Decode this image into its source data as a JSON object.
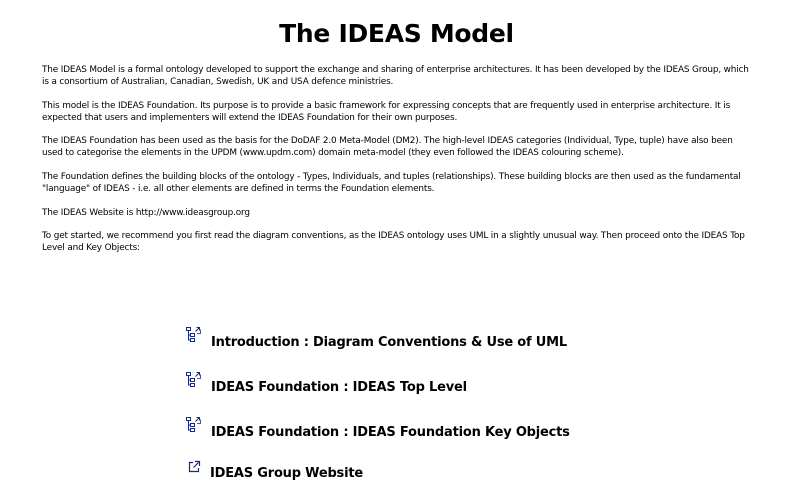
{
  "page": {
    "title": "The IDEAS Model"
  },
  "intro": {
    "paragraphs": [
      "The IDEAS Model is a formal ontology developed to support the exchange and sharing of enterprise architectures. It has been developed by the IDEAS Group, which is a consortium of Australian, Canadian, Swedish, UK and USA defence ministries.",
      "This model is the IDEAS Foundation. Its purpose is to provide a basic framework for expressing concepts that are frequently used in enterprise architecture. It is expected that users and implementers will extend the IDEAS Foundation for their own purposes.",
      "The IDEAS Foundation has been used as the basis for the DoDAF 2.0 Meta-Model (DM2). The high-level IDEAS categories (Individual, Type, tuple) have also been used to categorise the elements in the UPDM (www.updm.com) domain meta-model (they even followed the IDEAS colouring scheme).",
      "The Foundation defines the building blocks of the ontology - Types, Individuals, and tuples (relationships). These building blocks are then used as the fundamental \"language\" of IDEAS - i.e. all other elements are defined in terms the Foundation elements.",
      "The IDEAS Website is http://www.ideasgroup.org",
      "To get started, we recommend you first read the diagram conventions, as the IDEAS ontology uses UML in a slightly unusual way. Then proceed onto the IDEAS Top Level and Key Objects:"
    ]
  },
  "links": [
    {
      "label": "Introduction : Diagram Conventions & Use of UML",
      "icon": "diagram-link-icon"
    },
    {
      "label": "IDEAS Foundation : IDEAS Top Level",
      "icon": "diagram-link-icon"
    },
    {
      "label": "IDEAS Foundation : IDEAS Foundation Key Objects",
      "icon": "diagram-link-icon"
    },
    {
      "label": "IDEAS Group Website",
      "icon": "external-link-icon"
    }
  ],
  "colors": {
    "text": "#000000",
    "icon": "#1a2a7a",
    "background": "#ffffff"
  }
}
